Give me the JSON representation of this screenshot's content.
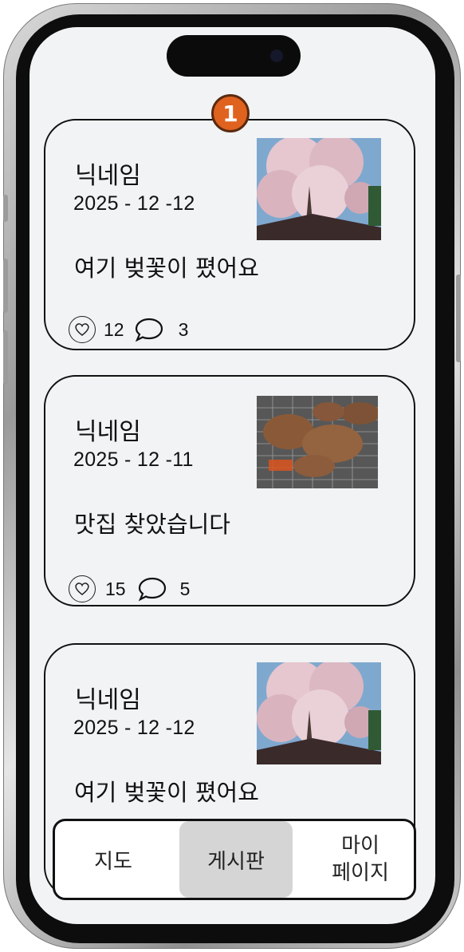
{
  "posts": [
    {
      "nickname": "닉네임",
      "date": "2025 - 12 -12",
      "content": "여기 벚꽃이 폈어요",
      "likes": "12",
      "comments": "3",
      "image": "cherry-blossom-photo"
    },
    {
      "nickname": "닉네임",
      "date": "2025 - 12 -11",
      "content": "맛집 찾았습니다",
      "likes": "15",
      "comments": "5",
      "image": "grilled-meat-photo"
    },
    {
      "nickname": "닉네임",
      "date": "2025 - 12 -12",
      "content": "여기 벚꽃이 폈어요",
      "image": "cherry-blossom-photo"
    }
  ],
  "annotation": {
    "badge": "1",
    "color": "#e0621f"
  },
  "nav": {
    "items": [
      {
        "label": "지도"
      },
      {
        "label": "게시판",
        "active": true
      },
      {
        "label_line1": "마이",
        "label_line2": "페이지"
      }
    ]
  },
  "icons": {
    "like": "heart-icon",
    "comment": "comment-bubble-icon"
  }
}
